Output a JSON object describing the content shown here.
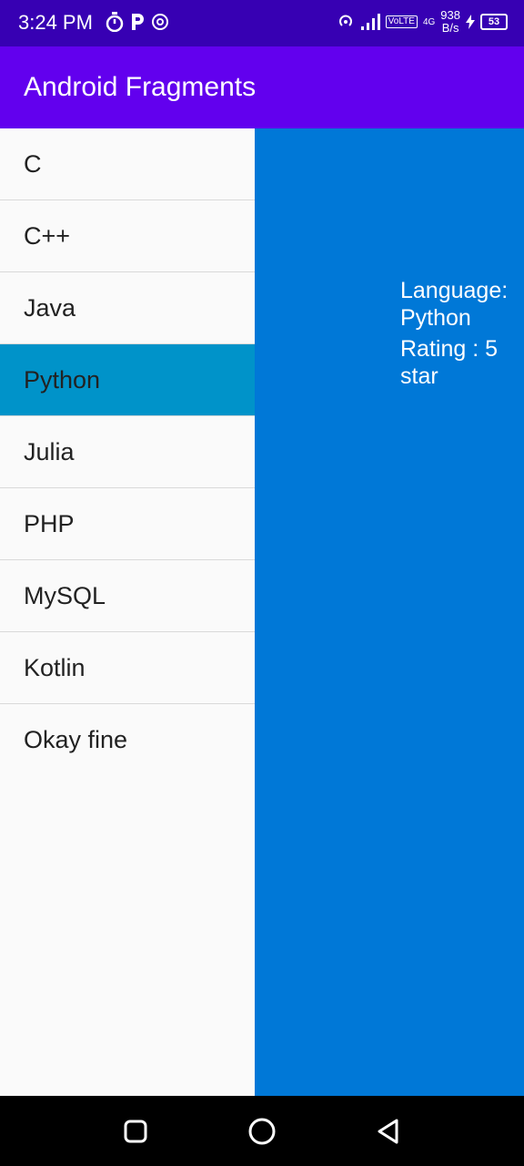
{
  "status_bar": {
    "time": "3:24 PM",
    "net_speed_value": "938",
    "net_speed_unit": "B/s",
    "volte": "VoLTE",
    "network": "4G",
    "battery": "53",
    "icons": [
      "timer-icon",
      "p-app-icon",
      "signal-app-icon",
      "hotspot-icon",
      "signal-bars-icon",
      "charging-icon"
    ]
  },
  "app_bar": {
    "title": "Android Fragments"
  },
  "list": {
    "items": [
      {
        "label": "C"
      },
      {
        "label": "C++"
      },
      {
        "label": "Java"
      },
      {
        "label": "Python"
      },
      {
        "label": "Julia"
      },
      {
        "label": "PHP"
      },
      {
        "label": "MySQL"
      },
      {
        "label": "Kotlin"
      },
      {
        "label": "Okay fine"
      }
    ],
    "selected_index": 3,
    "selected_color": "#0093c9"
  },
  "detail": {
    "language_text": "Language: Python",
    "rating_text": "Rating : 5 star",
    "background": "#0078d7"
  },
  "nav_bar": {
    "buttons": [
      "recents-icon",
      "home-icon",
      "back-icon"
    ]
  }
}
